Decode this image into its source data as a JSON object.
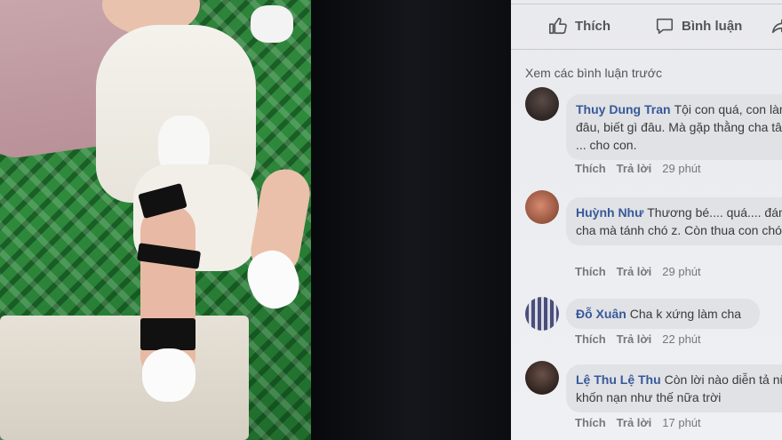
{
  "actions": {
    "like": "Thích",
    "comment": "Bình luận"
  },
  "prev_comments": "Xem các bình luận trước",
  "comments": [
    {
      "author": "Thuy Dung Tran",
      "text": "Tội con quá, con làm gì đâu, biết gì đâu. Mà gặp thằng cha tâm lý ... cho con.",
      "like": "Thích",
      "reply": "Trả lời",
      "time": "29 phút"
    },
    {
      "author": "Huỳnh Như",
      "text": "Thương bé.... quá.... đáng ... cha mà tánh chó z. Còn thua con chó .",
      "like": "Thích",
      "reply": "Trả lời",
      "time": "29 phút"
    },
    {
      "author": "Đỗ Xuân",
      "text": "Cha k xứng làm cha",
      "like": "Thích",
      "reply": "Trả lời",
      "time": "22 phút"
    },
    {
      "author": "Lệ Thu Lệ Thu",
      "text": "Còn lời nào diễn tả nữa khốn nạn như thế nữa trời",
      "like": "Thích",
      "reply": "Trả lời",
      "time": "17 phút"
    }
  ]
}
